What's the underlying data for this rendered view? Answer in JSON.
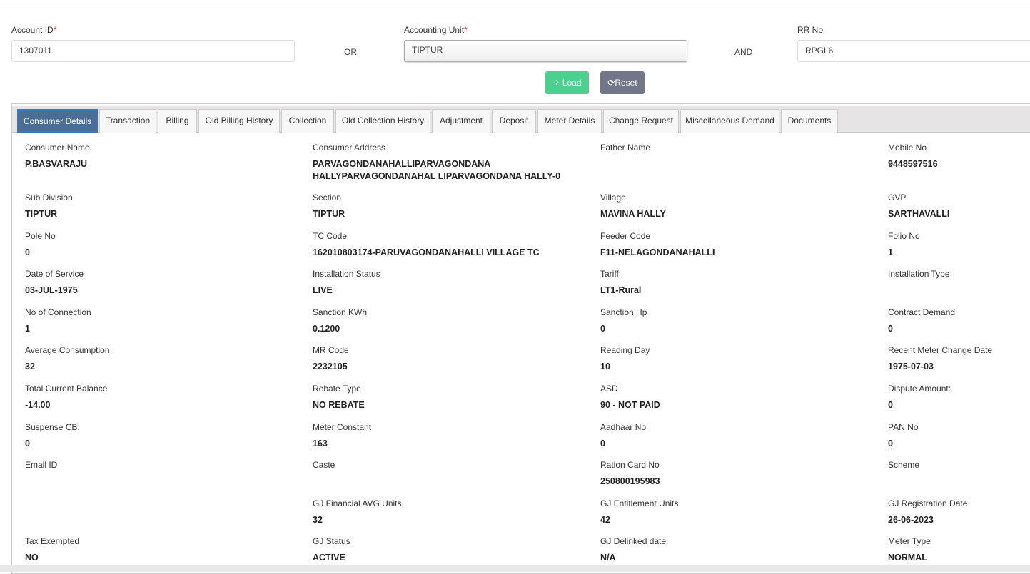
{
  "search": {
    "account_id": {
      "label": "Account ID",
      "required": "*",
      "value": "1307011"
    },
    "or_label": "OR",
    "accounting_unit": {
      "label": "Accounting Unit",
      "required": "*",
      "value": "TIPTUR"
    },
    "and_label": "AND",
    "rr_no": {
      "label": "RR No",
      "value": "RPGL6"
    },
    "load_label": "Load",
    "reset_label": "Reset"
  },
  "tabs": [
    {
      "label": "Consumer Details",
      "active": true
    },
    {
      "label": "Transaction"
    },
    {
      "label": "Billing"
    },
    {
      "label": "Old Billing History"
    },
    {
      "label": "Collection"
    },
    {
      "label": "Old Collection History"
    },
    {
      "label": "Adjustment"
    },
    {
      "label": "Deposit"
    },
    {
      "label": "Meter Details"
    },
    {
      "label": "Change Request"
    },
    {
      "label": "Miscellaneous Demand"
    },
    {
      "label": "Documents"
    }
  ],
  "fields": [
    [
      {
        "label": "Consumer Name",
        "value": "P.BASVARAJU"
      },
      {
        "label": "Consumer Address",
        "value": "PARVAGONDANAHALLIPARVAGONDANA HALLYPARVAGONDANAHAL LIPARVAGONDANA HALLY-0"
      },
      {
        "label": "Father Name",
        "value": ""
      },
      {
        "label": "Mobile No",
        "value": "9448597516"
      }
    ],
    [
      {
        "label": "Sub Division",
        "value": "TIPTUR"
      },
      {
        "label": "Section",
        "value": "TIPTUR"
      },
      {
        "label": "Village",
        "value": "MAVINA HALLY"
      },
      {
        "label": "GVP",
        "value": "SARTHAVALLI"
      }
    ],
    [
      {
        "label": "Pole No",
        "value": "0"
      },
      {
        "label": "TC Code",
        "value": "162010803174-PARUVAGONDANAHALLI VILLAGE TC"
      },
      {
        "label": "Feeder Code",
        "value": "F11-NELAGONDANAHALLI"
      },
      {
        "label": "Folio No",
        "value": "1"
      }
    ],
    [
      {
        "label": "Date of Service",
        "value": "03-JUL-1975"
      },
      {
        "label": "Installation Status",
        "value": "LIVE"
      },
      {
        "label": "Tariff",
        "value": "LT1-Rural"
      },
      {
        "label": "Installation Type",
        "value": ""
      }
    ],
    [
      {
        "label": "No of Connection",
        "value": "1"
      },
      {
        "label": "Sanction KWh",
        "value": "0.1200"
      },
      {
        "label": "Sanction Hp",
        "value": "0"
      },
      {
        "label": "Contract Demand",
        "value": "0"
      }
    ],
    [
      {
        "label": "Average Consumption",
        "value": "32"
      },
      {
        "label": "MR Code",
        "value": "2232105"
      },
      {
        "label": "Reading Day",
        "value": "10"
      },
      {
        "label": "Recent Meter Change Date",
        "value": "1975-07-03"
      }
    ],
    [
      {
        "label": "Total Current Balance",
        "value": "-14.00"
      },
      {
        "label": "Rebate Type",
        "value": "NO REBATE"
      },
      {
        "label": "ASD",
        "value": "90 - NOT PAID"
      },
      {
        "label": "Dispute Amount:",
        "value": "0"
      }
    ],
    [
      {
        "label": "Suspense CB:",
        "value": "0"
      },
      {
        "label": "Meter Constant",
        "value": "163"
      },
      {
        "label": "Aadhaar No",
        "value": "0"
      },
      {
        "label": "PAN No",
        "value": "0"
      }
    ],
    [
      {
        "label": "Email ID",
        "value": ""
      },
      {
        "label": "Caste",
        "value": ""
      },
      {
        "label": "Ration Card No",
        "value": "250800195983"
      },
      {
        "label": "Scheme",
        "value": ""
      }
    ],
    [
      {
        "label": "",
        "value": ""
      },
      {
        "label": "GJ Financial AVG Units",
        "value": "32"
      },
      {
        "label": "GJ Entitlement Units",
        "value": "42"
      },
      {
        "label": "GJ Registration Date",
        "value": "26-06-2023"
      }
    ],
    [
      {
        "label": "Tax Exempted",
        "value": "NO"
      },
      {
        "label": "GJ Status",
        "value": "ACTIVE"
      },
      {
        "label": "GJ Delinked date",
        "value": "N/A"
      },
      {
        "label": "Meter Type",
        "value": "NORMAL"
      }
    ]
  ]
}
